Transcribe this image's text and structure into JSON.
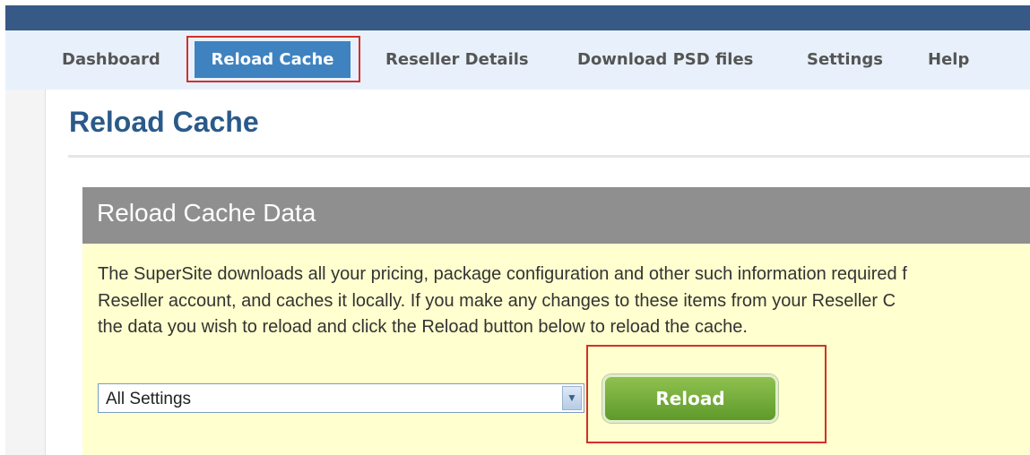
{
  "nav": {
    "items": [
      {
        "label": "Dashboard"
      },
      {
        "label": "Reload Cache",
        "active": true
      },
      {
        "label": "Reseller Details"
      },
      {
        "label": "Download PSD files"
      },
      {
        "label": "Settings"
      },
      {
        "label": "Help"
      }
    ]
  },
  "page": {
    "title": "Reload Cache"
  },
  "panel": {
    "title": "Reload Cache Data",
    "description_lines": [
      "The SuperSite downloads all your pricing, package configuration and other such information required f",
      "Reseller account, and caches it locally. If you make any changes to these items from your Reseller C",
      "the data you wish to reload and click the Reload button below to reload the cache."
    ],
    "select": {
      "selected": "All Settings"
    },
    "reload_label": "Reload"
  },
  "colors": {
    "topbar": "#365a85",
    "nav_bg": "#e8f1fb",
    "nav_active": "#3f82c0",
    "title": "#2a5a8a",
    "panel_head": "#8f8f8f",
    "panel_body": "#ffffcf",
    "reload_button": "#6fa837",
    "highlight_outline": "#d4302a"
  }
}
